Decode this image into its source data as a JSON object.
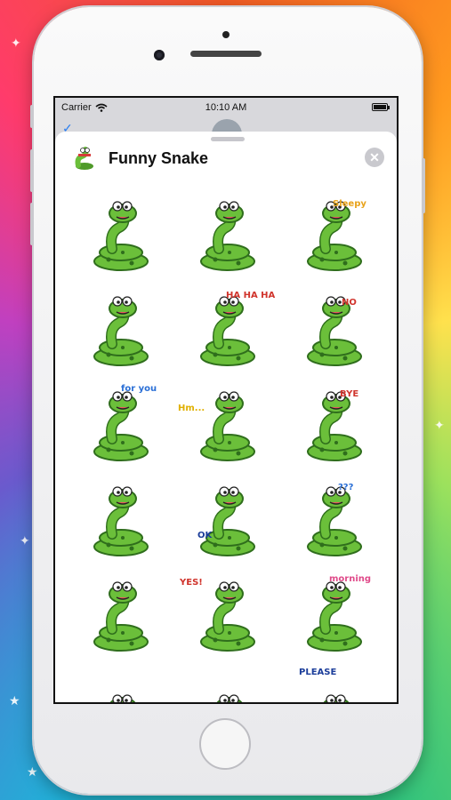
{
  "status_bar": {
    "carrier": "Carrier",
    "time": "10:10 AM"
  },
  "sheet": {
    "title": "Funny Snake",
    "close_symbol": "✕"
  },
  "stickers": [
    {
      "name": "sticker-love-flower",
      "caption": ""
    },
    {
      "name": "sticker-nervous",
      "caption": ""
    },
    {
      "name": "sticker-sleepy",
      "caption": "Sleepy"
    },
    {
      "name": "sticker-coiled-tired",
      "caption": ""
    },
    {
      "name": "sticker-laughing",
      "caption": "HA HA HA"
    },
    {
      "name": "sticker-no",
      "caption": "NO"
    },
    {
      "name": "sticker-for-you-gift",
      "caption": "for you"
    },
    {
      "name": "sticker-hmm",
      "caption": "Hm..."
    },
    {
      "name": "sticker-bye",
      "caption": "BYE"
    },
    {
      "name": "sticker-studying",
      "caption": ""
    },
    {
      "name": "sticker-ok",
      "caption": "OK"
    },
    {
      "name": "sticker-confused",
      "caption": "???"
    },
    {
      "name": "sticker-hearts",
      "caption": ""
    },
    {
      "name": "sticker-yes",
      "caption": "YES!"
    },
    {
      "name": "sticker-morning",
      "caption": "morning"
    },
    {
      "name": "sticker-partial-1",
      "caption": ""
    },
    {
      "name": "sticker-partial-2",
      "caption": ""
    },
    {
      "name": "sticker-please",
      "caption": "PLEASE"
    }
  ],
  "colors": {
    "snake_green": "#6bbf3a",
    "snake_dark": "#2f6e1c",
    "accent_blue": "#2a7ef0"
  }
}
